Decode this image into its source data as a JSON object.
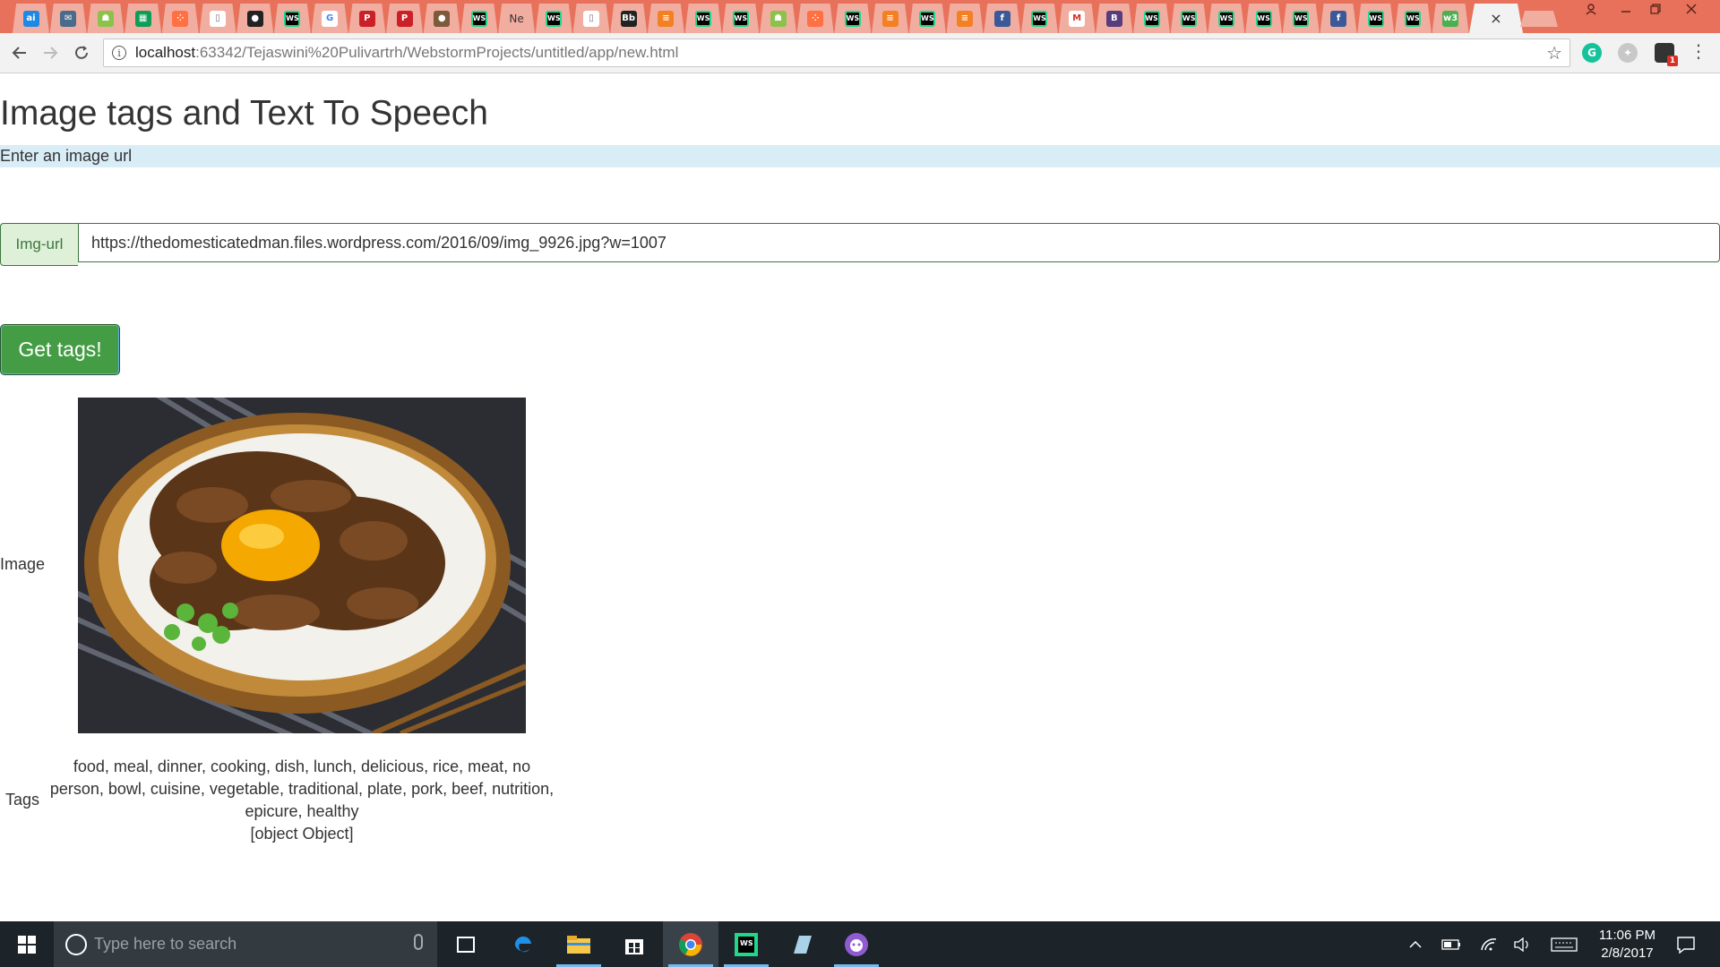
{
  "browser": {
    "tab_icons": [
      "ai-icon",
      "mail-icon",
      "android-icon",
      "sheets-icon",
      "dots-icon",
      "doc-icon",
      "github-icon",
      "webstorm-icon",
      "google-icon",
      "pinterest-icon",
      "pinterest-icon",
      "avatar-icon",
      "webstorm-icon",
      "ne-icon",
      "webstorm-icon",
      "doc-icon",
      "bb-icon",
      "stack-icon",
      "webstorm-icon",
      "webstorm-icon",
      "android-icon",
      "dots-icon",
      "webstorm-icon",
      "stack-icon",
      "webstorm-icon",
      "stack-icon",
      "facebook-icon",
      "webstorm-icon",
      "gmail-icon",
      "bootstrap-icon",
      "webstorm-icon",
      "webstorm-icon",
      "webstorm-icon",
      "webstorm-icon",
      "webstorm-icon",
      "facebook-icon",
      "webstorm-icon",
      "webstorm-icon",
      "w3-icon"
    ],
    "tab_ne_label": "Ne",
    "active_tab_close": "×",
    "url_host": "localhost",
    "url_path": ":63342/Tejaswini%20Pulivartrh/WebstormProjects/untitled/app/new.html"
  },
  "page": {
    "title": "Image tags and Text To Speech",
    "prompt": "Enter an image url",
    "input_addon": "Img-url",
    "input_value": "https://thedomesticatedman.files.wordpress.com/2016/09/img_9926.jpg?w=1007",
    "button_label": "Get tags!",
    "image_label": "Image",
    "tags_label": "Tags",
    "tags_text": "food, meal, dinner, cooking, dish, lunch, delicious, rice, meat, no person, bowl, cuisine, vegetable, traditional, plate, pork, beef, nutrition, epicure, healthy",
    "tags_extra": "[object Object]"
  },
  "taskbar": {
    "search_placeholder": "Type here to search",
    "time": "11:06 PM",
    "date": "2/8/2017"
  },
  "colors": {
    "tabstrip": "#e8715b",
    "info_bar": "#d9edf7",
    "success_green": "#449d44",
    "addon_bg": "#dff0d8",
    "taskbar": "#1c2329"
  }
}
